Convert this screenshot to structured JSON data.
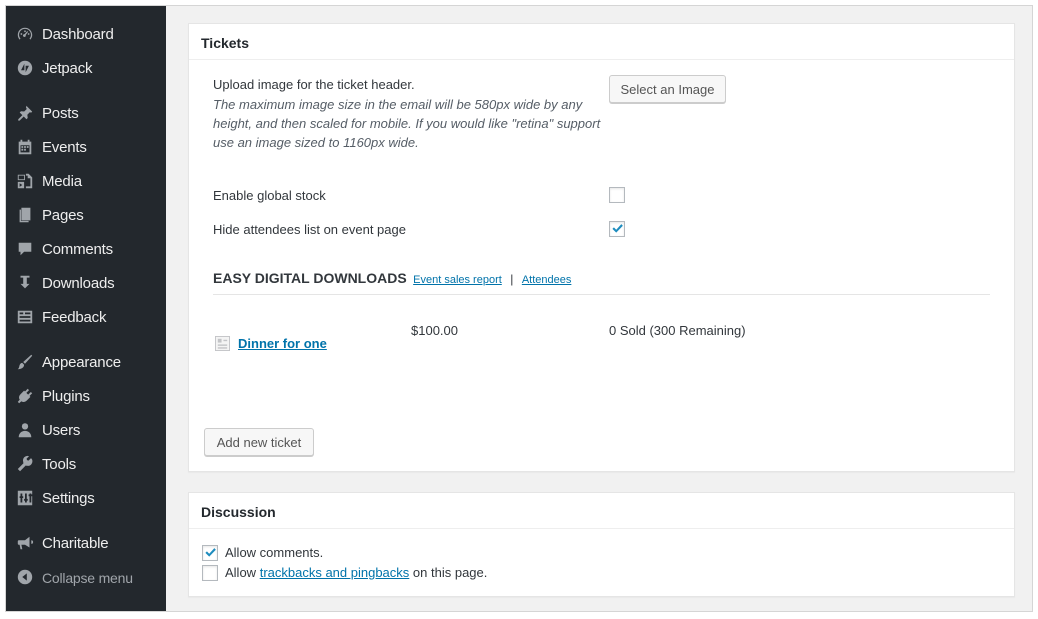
{
  "sidebar": {
    "items": [
      {
        "label": "Dashboard",
        "icon": "dashboard-icon"
      },
      {
        "label": "Jetpack",
        "icon": "jetpack-icon"
      },
      {
        "label": "Posts",
        "icon": "pin-icon"
      },
      {
        "label": "Events",
        "icon": "calendar-icon"
      },
      {
        "label": "Media",
        "icon": "media-icon"
      },
      {
        "label": "Pages",
        "icon": "pages-icon"
      },
      {
        "label": "Comments",
        "icon": "comment-icon"
      },
      {
        "label": "Downloads",
        "icon": "download-icon"
      },
      {
        "label": "Feedback",
        "icon": "feedback-icon"
      },
      {
        "label": "Appearance",
        "icon": "paintbrush-icon"
      },
      {
        "label": "Plugins",
        "icon": "plugin-icon"
      },
      {
        "label": "Users",
        "icon": "user-icon"
      },
      {
        "label": "Tools",
        "icon": "wrench-icon"
      },
      {
        "label": "Settings",
        "icon": "settings-icon"
      },
      {
        "label": "Charitable",
        "icon": "megaphone-icon"
      },
      {
        "label": "Collapse menu",
        "icon": "collapse-icon"
      }
    ]
  },
  "tickets": {
    "title": "Tickets",
    "upload_label": "Upload image for the ticket header.",
    "upload_description": "The maximum image size in the email will be 580px wide by any height, and then scaled for mobile. If you would like \"retina\" support use an image sized to 1160px wide.",
    "select_image_button": "Select an Image",
    "global_stock_label": "Enable global stock",
    "global_stock_checked": false,
    "hide_attendees_label": "Hide attendees list on event page",
    "hide_attendees_checked": true,
    "provider_heading": "EASY DIGITAL DOWNLOADS",
    "sales_report_link": "Event sales report",
    "separator": "|",
    "attendees_link": "Attendees",
    "ticket_list": [
      {
        "name": "Dinner for one",
        "price": "$100.00",
        "status": "0 Sold (300 Remaining)"
      }
    ],
    "add_ticket_button": "Add new ticket"
  },
  "discussion": {
    "title": "Discussion",
    "allow_comments_label": "Allow comments.",
    "allow_comments_checked": true,
    "allow_prefix": "Allow",
    "trackbacks_link": "trackbacks and pingbacks",
    "allow_suffix": "on this page.",
    "allow_pings_checked": false
  },
  "colors": {
    "sidebar_bg": "#23282d",
    "link": "#0073aa",
    "check": "#1e8cbe",
    "page_bg": "#f1f1f1"
  }
}
